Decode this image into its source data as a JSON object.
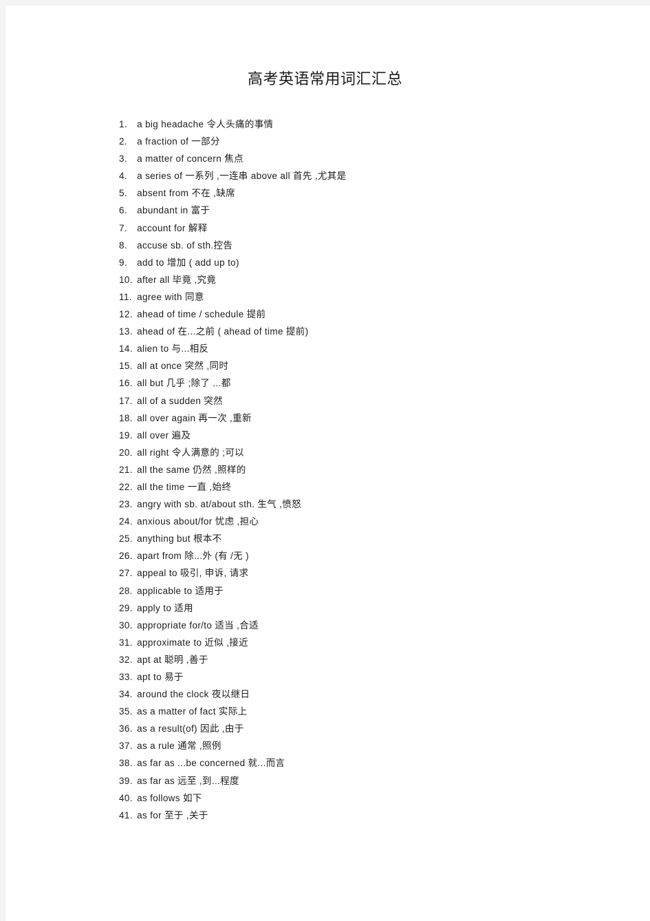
{
  "document": {
    "title": "高考英语常用词汇汇总",
    "page_background": "#ffffff",
    "canvas_background": "#f4f4f4",
    "text_color": "#1c1c1c"
  },
  "vocab": {
    "items": [
      {
        "num": "1.",
        "text": "a big headache 令人头痛的事情"
      },
      {
        "num": "2.",
        "text": "a fraction of   一部分"
      },
      {
        "num": "3.",
        "text": "a matter of concern   焦点"
      },
      {
        "num": "4.",
        "text": "a series of  一系列 ,一连串  above all   首先 ,尤其是"
      },
      {
        "num": "5.",
        "text": "absent from 不在 ,缺席"
      },
      {
        "num": "6.",
        "text": "abundant in 富于"
      },
      {
        "num": "7.",
        "text": "account for  解释"
      },
      {
        "num": "8.",
        "text": "accuse sb. of sth.控告"
      },
      {
        "num": "9.",
        "text": "add to 增加 ( add up to)"
      },
      {
        "num": "10.",
        "text": "after all   毕竟 ,究竟"
      },
      {
        "num": "11.",
        "text": "agree with 同意"
      },
      {
        "num": "12.",
        "text": "ahead of time / schedule 提前"
      },
      {
        "num": "13.",
        "text": "ahead of  在...之前 ( ahead of time   提前)"
      },
      {
        "num": "14.",
        "text": "alien to 与...相反"
      },
      {
        "num": "15.",
        "text": "all at once   突然 ,同时"
      },
      {
        "num": "16.",
        "text": "all but   几乎 ;除了 ...都"
      },
      {
        "num": "17.",
        "text": "all of a sudden   突然"
      },
      {
        "num": "18.",
        "text": "all over again   再一次 ,重新"
      },
      {
        "num": "19.",
        "text": "all over   遍及"
      },
      {
        "num": "20.",
        "text": "all right   令人满意的  ;可以"
      },
      {
        "num": "21.",
        "text": "all the same   仍然 ,照样的"
      },
      {
        "num": "22.",
        "text": "all the time   一直 ,始终"
      },
      {
        "num": "23.",
        "text": "angry with sb. at/about sth. 生气 ,愤怒"
      },
      {
        "num": "24.",
        "text": "anxious about/for   忧虑 ,担心"
      },
      {
        "num": "25.",
        "text": "anything but   根本不"
      },
      {
        "num": "26.",
        "text": "apart from   除...外 (有 /无 )"
      },
      {
        "num": "27.",
        "text": "appeal to  吸引, 申诉, 请求"
      },
      {
        "num": "28.",
        "text": "applicable to  适用于"
      },
      {
        "num": "29.",
        "text": "apply to 适用"
      },
      {
        "num": "30.",
        "text": "appropriate for/to   适当 ,合适"
      },
      {
        "num": "31.",
        "text": "approximate to  近似 ,接近"
      },
      {
        "num": "32.",
        "text": "apt at 聪明 ,善于"
      },
      {
        "num": "33.",
        "text": "apt to 易于"
      },
      {
        "num": "34.",
        "text": "around the clock  夜以继日"
      },
      {
        "num": "35.",
        "text": "as a matter of fact   实际上"
      },
      {
        "num": "36.",
        "text": "as a result(of)   因此 ,由于"
      },
      {
        "num": "37.",
        "text": "as a rule  通常 ,照例"
      },
      {
        "num": "38.",
        "text": "as far as ...be concerned   就...而言"
      },
      {
        "num": "39.",
        "text": "as far as  远至 ,到...程度"
      },
      {
        "num": "40.",
        "text": "as follows   如下"
      },
      {
        "num": "41.",
        "text": "as for   至于 ,关于"
      }
    ]
  }
}
